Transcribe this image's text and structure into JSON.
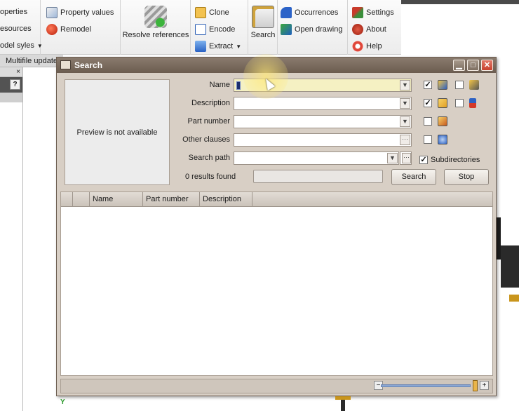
{
  "ribbon": {
    "col1": {
      "properties": "operties",
      "resources": "esources",
      "model_styles": "odel syles"
    },
    "col2": {
      "property_values": "Property values",
      "remodel": "Remodel"
    },
    "resolve": "Resolve references",
    "col3": {
      "clone": "Clone",
      "encode": "Encode",
      "extract": "Extract"
    },
    "search": "Search",
    "col4": {
      "occurrences": "Occurrences",
      "open_drawing": "Open drawing"
    },
    "col5": {
      "settings": "Settings",
      "about": "About",
      "help": "Help"
    }
  },
  "doc_tab": "Multifile update",
  "left_panel": {
    "close_glyph": "×",
    "help_glyph": "?"
  },
  "dialog": {
    "title": "Search",
    "preview_text": "Preview is not available",
    "fields": {
      "name": "Name",
      "description": "Description",
      "part_number": "Part number",
      "other_clauses": "Other clauses",
      "search_path": "Search path"
    },
    "subdirectories_label": "Subdirectories",
    "results_found": "0 results found",
    "search_button": "Search",
    "stop_button": "Stop",
    "columns": [
      "Name",
      "Part number",
      "Description"
    ]
  },
  "colors": {
    "dialog_frame": "#6b5c4f",
    "dialog_body": "#d8cfc5",
    "highlight": "#f5f1c3"
  }
}
